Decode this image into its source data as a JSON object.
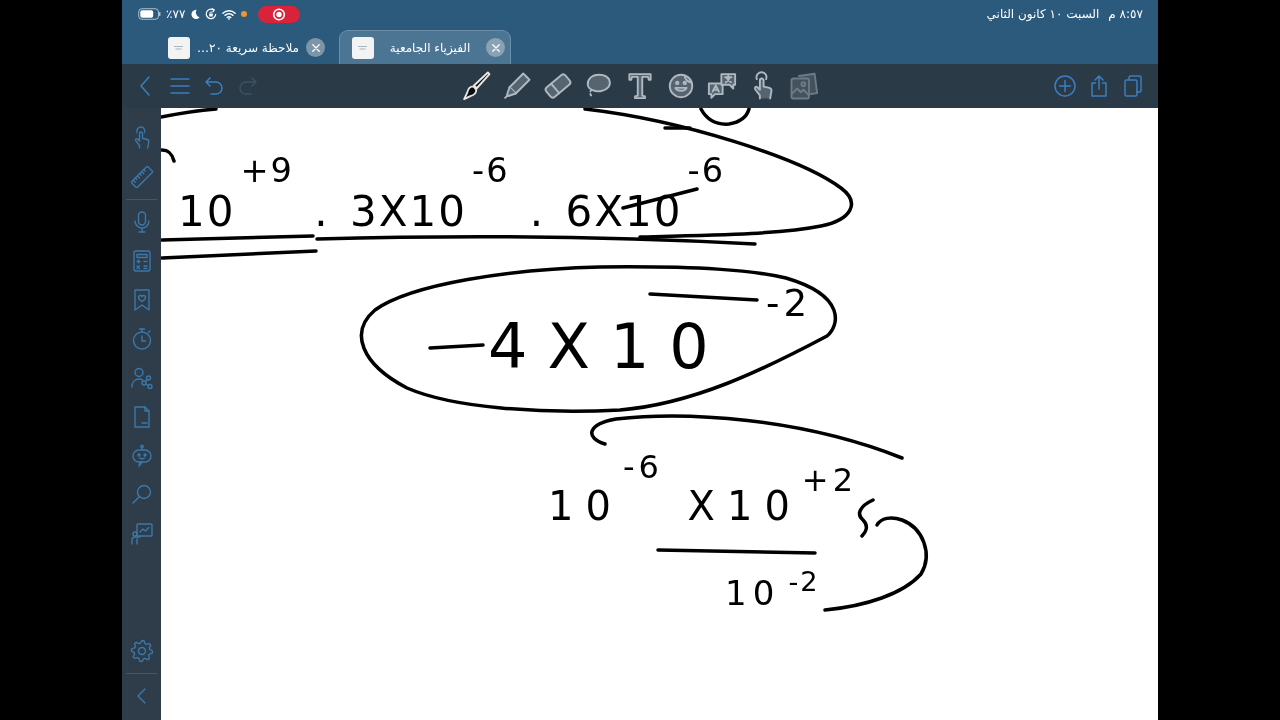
{
  "status_bar": {
    "battery": "٧٧٪",
    "time": "٨:٥٧ م",
    "date": "السبت ١٠ كانون الثاني"
  },
  "tabs": [
    {
      "title": "الفيزياء الجامعية",
      "selected": true
    },
    {
      "title": "ملاحظة سريعة ٢٠…",
      "selected": false
    }
  ],
  "toolbar": {
    "nav": [
      {
        "kind": "back",
        "disabled": false
      },
      {
        "kind": "menu",
        "disabled": false
      },
      {
        "kind": "undo",
        "disabled": false
      },
      {
        "kind": "redo",
        "disabled": true
      }
    ],
    "tools": [
      {
        "kind": "brush",
        "selected": true,
        "disabled": false
      },
      {
        "kind": "marker",
        "selected": false,
        "disabled": false
      },
      {
        "kind": "eraser",
        "selected": false,
        "disabled": false
      },
      {
        "kind": "lasso",
        "selected": false,
        "disabled": false
      },
      {
        "kind": "text",
        "selected": false,
        "disabled": false
      },
      {
        "kind": "sticker",
        "selected": false,
        "disabled": false
      },
      {
        "kind": "translate",
        "selected": false,
        "disabled": false
      },
      {
        "kind": "hand",
        "selected": false,
        "disabled": false
      },
      {
        "kind": "photo",
        "selected": false,
        "disabled": true
      }
    ],
    "actions": [
      {
        "kind": "add"
      },
      {
        "kind": "share"
      },
      {
        "kind": "pages"
      }
    ]
  },
  "sidebar": {
    "top": [
      {
        "kind": "hand"
      },
      {
        "kind": "ruler"
      },
      {
        "kind": "divider"
      },
      {
        "kind": "mic"
      },
      {
        "kind": "calculator"
      },
      {
        "kind": "bookmark"
      },
      {
        "kind": "timer"
      },
      {
        "kind": "person-share"
      },
      {
        "kind": "document"
      },
      {
        "kind": "robot"
      },
      {
        "kind": "search"
      },
      {
        "kind": "board"
      }
    ],
    "bottom": [
      {
        "kind": "settings"
      },
      {
        "kind": "divider"
      },
      {
        "kind": "collapse"
      }
    ]
  },
  "canvas": {
    "notes": [
      "10$^{+9}$ . 3X10$^{-6}$ . 6X10$^{-6}$",
      "4X10$^{-2}$",
      "10$^{-6}$ X10$^{+2}$",
      "10$^{-2}$"
    ]
  }
}
